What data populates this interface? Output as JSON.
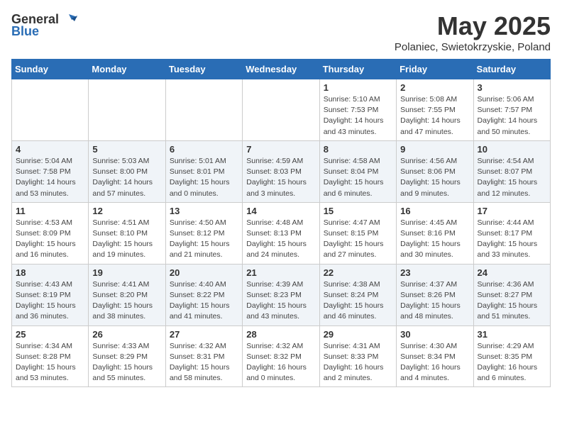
{
  "logo": {
    "general": "General",
    "blue": "Blue"
  },
  "title": "May 2025",
  "location": "Polaniec, Swietokrzyskie, Poland",
  "header_days": [
    "Sunday",
    "Monday",
    "Tuesday",
    "Wednesday",
    "Thursday",
    "Friday",
    "Saturday"
  ],
  "weeks": [
    [
      {
        "day": "",
        "detail": ""
      },
      {
        "day": "",
        "detail": ""
      },
      {
        "day": "",
        "detail": ""
      },
      {
        "day": "",
        "detail": ""
      },
      {
        "day": "1",
        "detail": "Sunrise: 5:10 AM\nSunset: 7:53 PM\nDaylight: 14 hours\nand 43 minutes."
      },
      {
        "day": "2",
        "detail": "Sunrise: 5:08 AM\nSunset: 7:55 PM\nDaylight: 14 hours\nand 47 minutes."
      },
      {
        "day": "3",
        "detail": "Sunrise: 5:06 AM\nSunset: 7:57 PM\nDaylight: 14 hours\nand 50 minutes."
      }
    ],
    [
      {
        "day": "4",
        "detail": "Sunrise: 5:04 AM\nSunset: 7:58 PM\nDaylight: 14 hours\nand 53 minutes."
      },
      {
        "day": "5",
        "detail": "Sunrise: 5:03 AM\nSunset: 8:00 PM\nDaylight: 14 hours\nand 57 minutes."
      },
      {
        "day": "6",
        "detail": "Sunrise: 5:01 AM\nSunset: 8:01 PM\nDaylight: 15 hours\nand 0 minutes."
      },
      {
        "day": "7",
        "detail": "Sunrise: 4:59 AM\nSunset: 8:03 PM\nDaylight: 15 hours\nand 3 minutes."
      },
      {
        "day": "8",
        "detail": "Sunrise: 4:58 AM\nSunset: 8:04 PM\nDaylight: 15 hours\nand 6 minutes."
      },
      {
        "day": "9",
        "detail": "Sunrise: 4:56 AM\nSunset: 8:06 PM\nDaylight: 15 hours\nand 9 minutes."
      },
      {
        "day": "10",
        "detail": "Sunrise: 4:54 AM\nSunset: 8:07 PM\nDaylight: 15 hours\nand 12 minutes."
      }
    ],
    [
      {
        "day": "11",
        "detail": "Sunrise: 4:53 AM\nSunset: 8:09 PM\nDaylight: 15 hours\nand 16 minutes."
      },
      {
        "day": "12",
        "detail": "Sunrise: 4:51 AM\nSunset: 8:10 PM\nDaylight: 15 hours\nand 19 minutes."
      },
      {
        "day": "13",
        "detail": "Sunrise: 4:50 AM\nSunset: 8:12 PM\nDaylight: 15 hours\nand 21 minutes."
      },
      {
        "day": "14",
        "detail": "Sunrise: 4:48 AM\nSunset: 8:13 PM\nDaylight: 15 hours\nand 24 minutes."
      },
      {
        "day": "15",
        "detail": "Sunrise: 4:47 AM\nSunset: 8:15 PM\nDaylight: 15 hours\nand 27 minutes."
      },
      {
        "day": "16",
        "detail": "Sunrise: 4:45 AM\nSunset: 8:16 PM\nDaylight: 15 hours\nand 30 minutes."
      },
      {
        "day": "17",
        "detail": "Sunrise: 4:44 AM\nSunset: 8:17 PM\nDaylight: 15 hours\nand 33 minutes."
      }
    ],
    [
      {
        "day": "18",
        "detail": "Sunrise: 4:43 AM\nSunset: 8:19 PM\nDaylight: 15 hours\nand 36 minutes."
      },
      {
        "day": "19",
        "detail": "Sunrise: 4:41 AM\nSunset: 8:20 PM\nDaylight: 15 hours\nand 38 minutes."
      },
      {
        "day": "20",
        "detail": "Sunrise: 4:40 AM\nSunset: 8:22 PM\nDaylight: 15 hours\nand 41 minutes."
      },
      {
        "day": "21",
        "detail": "Sunrise: 4:39 AM\nSunset: 8:23 PM\nDaylight: 15 hours\nand 43 minutes."
      },
      {
        "day": "22",
        "detail": "Sunrise: 4:38 AM\nSunset: 8:24 PM\nDaylight: 15 hours\nand 46 minutes."
      },
      {
        "day": "23",
        "detail": "Sunrise: 4:37 AM\nSunset: 8:26 PM\nDaylight: 15 hours\nand 48 minutes."
      },
      {
        "day": "24",
        "detail": "Sunrise: 4:36 AM\nSunset: 8:27 PM\nDaylight: 15 hours\nand 51 minutes."
      }
    ],
    [
      {
        "day": "25",
        "detail": "Sunrise: 4:34 AM\nSunset: 8:28 PM\nDaylight: 15 hours\nand 53 minutes."
      },
      {
        "day": "26",
        "detail": "Sunrise: 4:33 AM\nSunset: 8:29 PM\nDaylight: 15 hours\nand 55 minutes."
      },
      {
        "day": "27",
        "detail": "Sunrise: 4:32 AM\nSunset: 8:31 PM\nDaylight: 15 hours\nand 58 minutes."
      },
      {
        "day": "28",
        "detail": "Sunrise: 4:32 AM\nSunset: 8:32 PM\nDaylight: 16 hours\nand 0 minutes."
      },
      {
        "day": "29",
        "detail": "Sunrise: 4:31 AM\nSunset: 8:33 PM\nDaylight: 16 hours\nand 2 minutes."
      },
      {
        "day": "30",
        "detail": "Sunrise: 4:30 AM\nSunset: 8:34 PM\nDaylight: 16 hours\nand 4 minutes."
      },
      {
        "day": "31",
        "detail": "Sunrise: 4:29 AM\nSunset: 8:35 PM\nDaylight: 16 hours\nand 6 minutes."
      }
    ]
  ]
}
